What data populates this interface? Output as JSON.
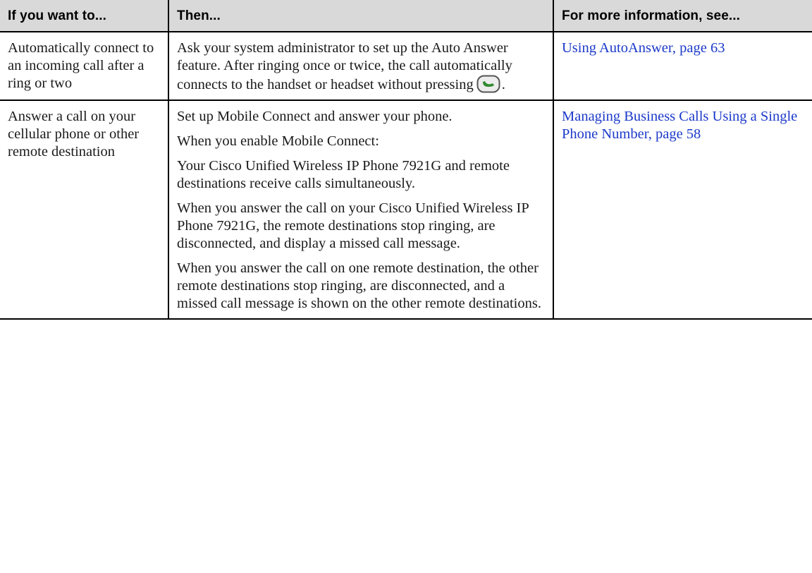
{
  "headers": {
    "col1": "If you want to...",
    "col2": "Then...",
    "col3": "For more information, see..."
  },
  "rows": [
    {
      "want": "Automatically connect to an incoming call after a ring or two",
      "then": [
        "Ask your system administrator to set up the Auto Answer feature. After ringing once or twice, the call automatically connects to the handset or headset without pressing"
      ],
      "then_suffix": ".",
      "key_icon": "answer-send-key-icon",
      "see": "Using AutoAnswer, page 63"
    },
    {
      "want": "Answer a call on your cellular phone or other remote destination",
      "then": [
        "Set up Mobile Connect and answer your phone.",
        "When you enable Mobile Connect:",
        "Your Cisco Unified Wireless IP Phone 7921G and remote destinations receive calls simultaneously.",
        "When you answer the call on your Cisco Unified Wireless IP Phone 7921G, the remote destinations stop ringing, are disconnected, and display a missed call message.",
        "When you answer the call on one remote destination, the other remote destinations stop ringing, are disconnected, and a missed call message is shown on the other remote destinations."
      ],
      "see": "Managing Business Calls Using a Single Phone Number, page 58"
    }
  ],
  "colors": {
    "header_bg": "#d9d9d9",
    "link": "#1b39c9",
    "border": "#000000",
    "key_green": "#2f8a2f"
  }
}
